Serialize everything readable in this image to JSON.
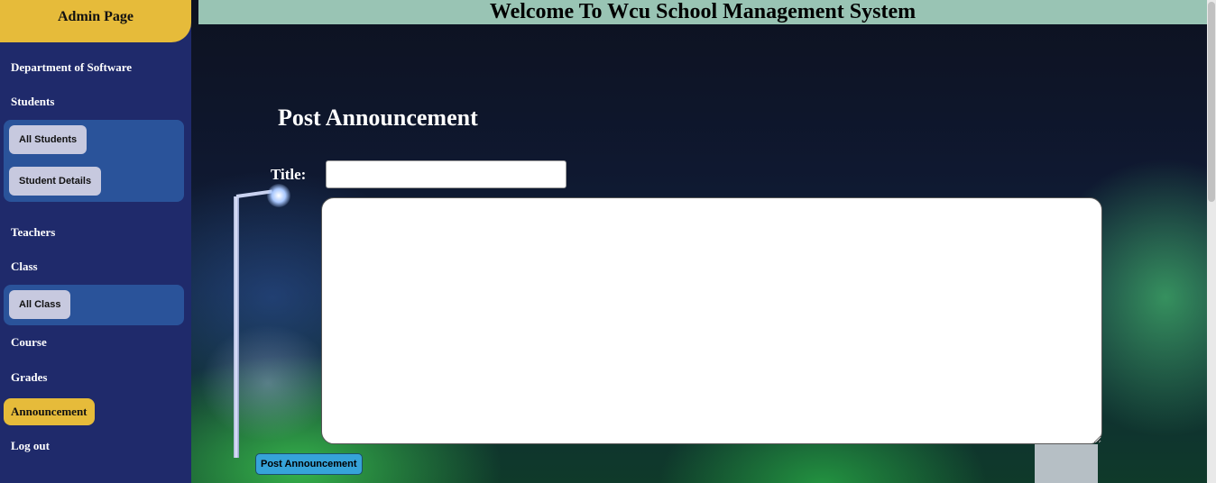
{
  "sidebar": {
    "title": "Admin Page",
    "items": {
      "department": "Department of Software",
      "students": "Students",
      "all_students": "All Students",
      "student_details": "Student Details",
      "teachers": "Teachers",
      "class": "Class",
      "all_class": "All Class",
      "course": "Course",
      "grades": "Grades",
      "announcement": "Announcement",
      "logout": "Log out"
    },
    "active_item": "Announcement",
    "colors": {
      "background": "#1f2a6b",
      "accent": "#e6bb3a",
      "submenu": "#2a539a",
      "sub_button": "#c7c9df"
    }
  },
  "header": {
    "title": "Welcome To Wcu School Management System",
    "background": "#99c4b4"
  },
  "form": {
    "heading": "Post Announcement",
    "title_label": "Title:",
    "title_value": "",
    "body_value": "",
    "submit_label": "Post Announcement",
    "submit_color": "#36a3d9"
  }
}
